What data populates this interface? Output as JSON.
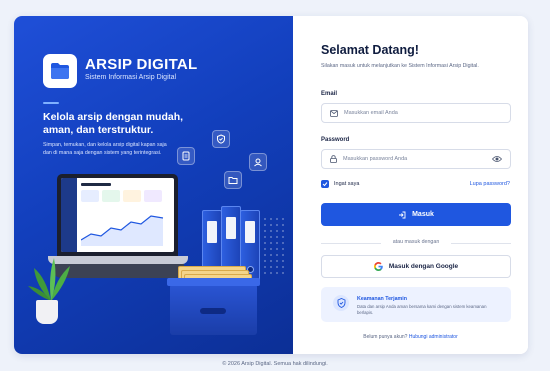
{
  "brand": {
    "name": "ARSIP DIGITAL",
    "subtitle": "Sistem Informasi Arsip Digital"
  },
  "hero": {
    "headline": "Kelola arsip dengan mudah, aman, dan terstruktur.",
    "description": "Simpan, temukan, dan kelola arsip digital kapan saja dan di mana saja dengan sistem yang terintegrasi."
  },
  "login": {
    "title": "Selamat Datang!",
    "subtitle": "Silakan masuk untuk melanjutkan ke Sistem Informasi Arsip Digital.",
    "email_label": "Email",
    "email_placeholder": "Masukkan email Anda",
    "password_label": "Password",
    "password_placeholder": "Masukkan password Anda",
    "remember_label": "Ingat saya",
    "remember_checked": true,
    "forgot_label": "Lupa password?",
    "submit_label": "Masuk",
    "divider_label": "atau masuk dengan",
    "google_label": "Masuk dengan Google"
  },
  "security": {
    "title": "Keamanan Terjamin",
    "text": "Data dan arsip Anda aman bersama kami dengan sistem keamanan berlapis."
  },
  "signup": {
    "question": "Belum punya akun?",
    "link": "Hubungi administrator"
  },
  "footer": "© 2026 Arsip Digital. Semua hak dilindungi.",
  "colors": {
    "primary": "#1f57e0",
    "panel_dark": "#0c2f96",
    "background": "#eef2fa"
  }
}
